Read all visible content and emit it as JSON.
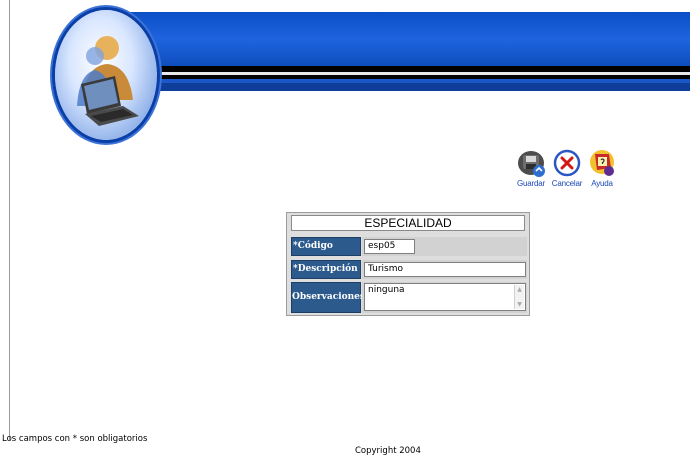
{
  "toolbar": {
    "guardar": "Guardar",
    "cancelar": "Cancelar",
    "ayuda": "Ayuda"
  },
  "form": {
    "title": "ESPECIALIDAD",
    "codigo_label": "*Código",
    "codigo_value": "esp05",
    "descripcion_label": "*Descripción",
    "descripcion_value": "Turismo",
    "observaciones_label": "Observaciones",
    "observaciones_value": "ninguna"
  },
  "footer": {
    "required_note": "Los campos con * son obligatorios",
    "copyright": "Copyright 2004"
  },
  "colors": {
    "banner_blue": "#1f64de",
    "label_bg": "#2c5a8d",
    "toolbar_text": "#1c49b7"
  },
  "icons": [
    "logo-emblem",
    "save-icon",
    "cancel-icon",
    "help-icon",
    "scroll-up-icon",
    "scroll-down-icon"
  ]
}
